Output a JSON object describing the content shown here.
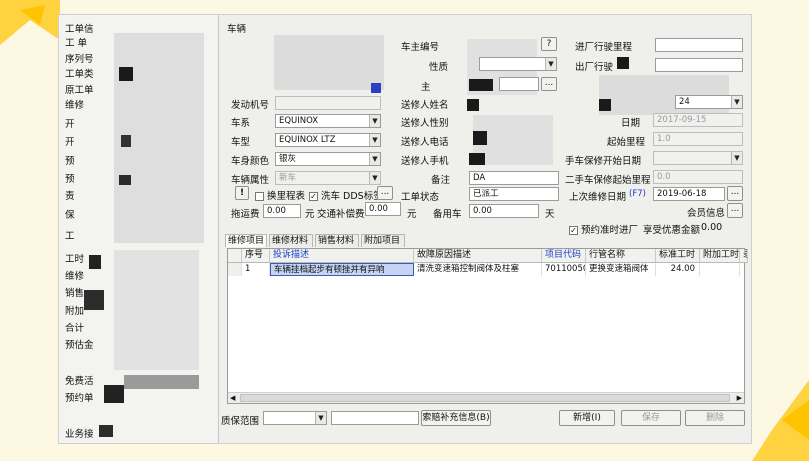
{
  "left_panel": {
    "labels": [
      "工单信",
      "工 单",
      "序列号",
      "工单类",
      "原工单",
      "维修",
      "开",
      "开",
      "预",
      "预",
      "责",
      "保",
      "工",
      "工时",
      "维修",
      "销售",
      "附加",
      "合计",
      "预估金",
      "免费活",
      "预约单",
      "业务接"
    ]
  },
  "vehicle": {
    "top_label": "车辆",
    "engine_no_label": "发动机号",
    "series_label": "车系",
    "series_value": "EQUINOX",
    "model_label": "车型",
    "model_value": "EQUINOX LTZ",
    "color_label": "车身颜色",
    "color_value": "银灰",
    "attr_label": "车辆属性",
    "attr_value": "新车"
  },
  "owner": {
    "owner_no_label": "车主编号",
    "nature_label": "性质",
    "owner_label": "主",
    "sender_name_label": "送修人姓名",
    "sender_gender_label": "送修人性别",
    "sender_phone_label": "送修人电话",
    "sender_mobile_label": "送修人手机",
    "remark_label": "备注",
    "remark_value": "DA",
    "order_status_label": "工单状态",
    "order_status_value": "已派工"
  },
  "right_info": {
    "entry_mileage_label": "进厂行驶里程",
    "exit_mileage_label": "出厂行驶",
    "day_label": "日期",
    "day_value": "2017-09-15",
    "start_mileage_label": "起始里程",
    "start_mileage_value": "1.0",
    "used_warranty_start_date_label": "手车保修开始日期",
    "used_warranty_start_mileage_label": "二手车保修起始里程",
    "used_warranty_start_mileage_value": "0.0",
    "last_repair_date_label": "上次维修日期",
    "last_repair_f7": "(F7)",
    "last_repair_date_value": "2019-06-18",
    "member_info_label": "会员信息",
    "ellipsis": "...",
    "question": "?",
    "dropdown_value": "24"
  },
  "options": {
    "exclaim": "!",
    "change_meter_label": "换里程表",
    "wash_label": "洗车 DDS标签",
    "wash_btn": "..."
  },
  "fees": {
    "tow_label": "拖运费",
    "tow_value": "0.00",
    "yuan1": "元",
    "transport_label": "交通补偿费",
    "transport_value": "0.00",
    "yuan2": "元",
    "spare_car_label": "备用车",
    "spare_car_value": "0.00",
    "day_unit": "天"
  },
  "reservation": {
    "label": "预约准时进厂",
    "discount_label": "享受优惠金额",
    "discount_value": "0.00"
  },
  "tabs": [
    "维修项目",
    "维修材料",
    "销售材料",
    "附加项目"
  ],
  "table": {
    "columns": [
      "序号",
      "投诉描述",
      "故障原因描述",
      "项目代码",
      "行管名称",
      "标准工时",
      "附加工时",
      "录"
    ],
    "rows": [
      [
        "1",
        "车辆挂档起步有顿挫并有异响",
        "清洗变速箱控制阀体及柱塞",
        "70110050",
        "更换变速箱阀体",
        "24.00",
        "",
        ""
      ]
    ]
  },
  "bottom": {
    "warranty_range_label": "质保范围",
    "claim_btn": "索赔补充信息(B)",
    "add_btn": "新增(I)",
    "save_btn": "保存",
    "delete_btn": "删除"
  },
  "colors": {
    "page_bg": "#fcf8e3",
    "deco_yellow": "#ffd23f",
    "grid_selected": "#c5d4f2",
    "link_blue": "#1a40c7"
  }
}
